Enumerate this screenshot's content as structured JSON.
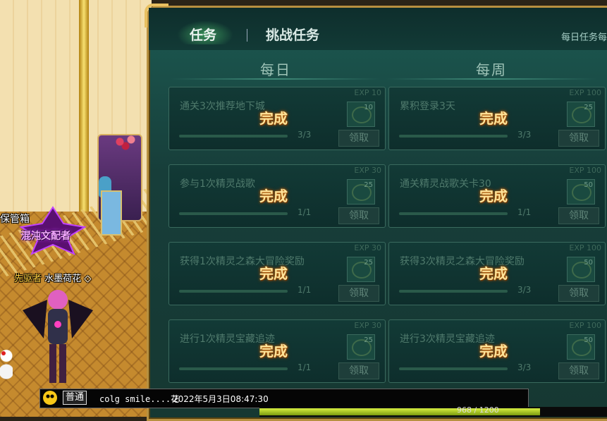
{
  "scene": {
    "chest_label": "保管箱",
    "guild_name": "混沌文配者",
    "player_title": "先驱者",
    "player_name": "水墨荷花"
  },
  "panel": {
    "tabs": [
      {
        "label": "任务",
        "active": true
      },
      {
        "label": "挑战任务",
        "active": false
      }
    ],
    "daily_note": "每日任务每",
    "columns": [
      "每日",
      "每周"
    ],
    "daily_quests": [
      {
        "name": "通关3次推荐地下城",
        "progress": "3/3",
        "exp": "EXP 10",
        "reward_qty": "10",
        "status": "完成",
        "claim": "领取"
      },
      {
        "name": "参与1次精灵战歌",
        "progress": "1/1",
        "exp": "EXP 30",
        "reward_qty": "25",
        "status": "完成",
        "claim": "领取"
      },
      {
        "name": "获得1次精灵之森大冒险奖励",
        "progress": "1/1",
        "exp": "EXP 30",
        "reward_qty": "25",
        "status": "完成",
        "claim": "领取"
      },
      {
        "name": "进行1次精灵宝藏追迹",
        "progress": "1/1",
        "exp": "EXP 30",
        "reward_qty": "25",
        "status": "完成",
        "claim": "领取"
      }
    ],
    "weekly_quests": [
      {
        "name": "累积登录3天",
        "progress": "3/3",
        "exp": "EXP 100",
        "reward_qty": "25",
        "status": "完成",
        "claim": "领取"
      },
      {
        "name": "通关精灵战歌关卡30",
        "progress": "1/1",
        "exp": "EXP 100",
        "reward_qty": "50",
        "status": "完成",
        "claim": "领取"
      },
      {
        "name": "获得3次精灵之森大冒险奖励",
        "progress": "3/3",
        "exp": "EXP 100",
        "reward_qty": "50",
        "status": "完成",
        "claim": "领取"
      },
      {
        "name": "进行3次精灵宝藏追迹",
        "progress": "3/3",
        "exp": "EXP 100",
        "reward_qty": "50",
        "status": "完成",
        "claim": "领取"
      }
    ]
  },
  "chat": {
    "channel": "普通",
    "message": "colg smile....花",
    "timestamp": "2022年5月3日08:47:30"
  },
  "status_bar": {
    "text": "968 / 1200",
    "fill_fraction": 0.807
  },
  "colors": {
    "panel_bg": "#173e3a",
    "panel_border": "#b89040",
    "done_text": "#ffe49a",
    "guild_text": "#f4a8ff"
  }
}
